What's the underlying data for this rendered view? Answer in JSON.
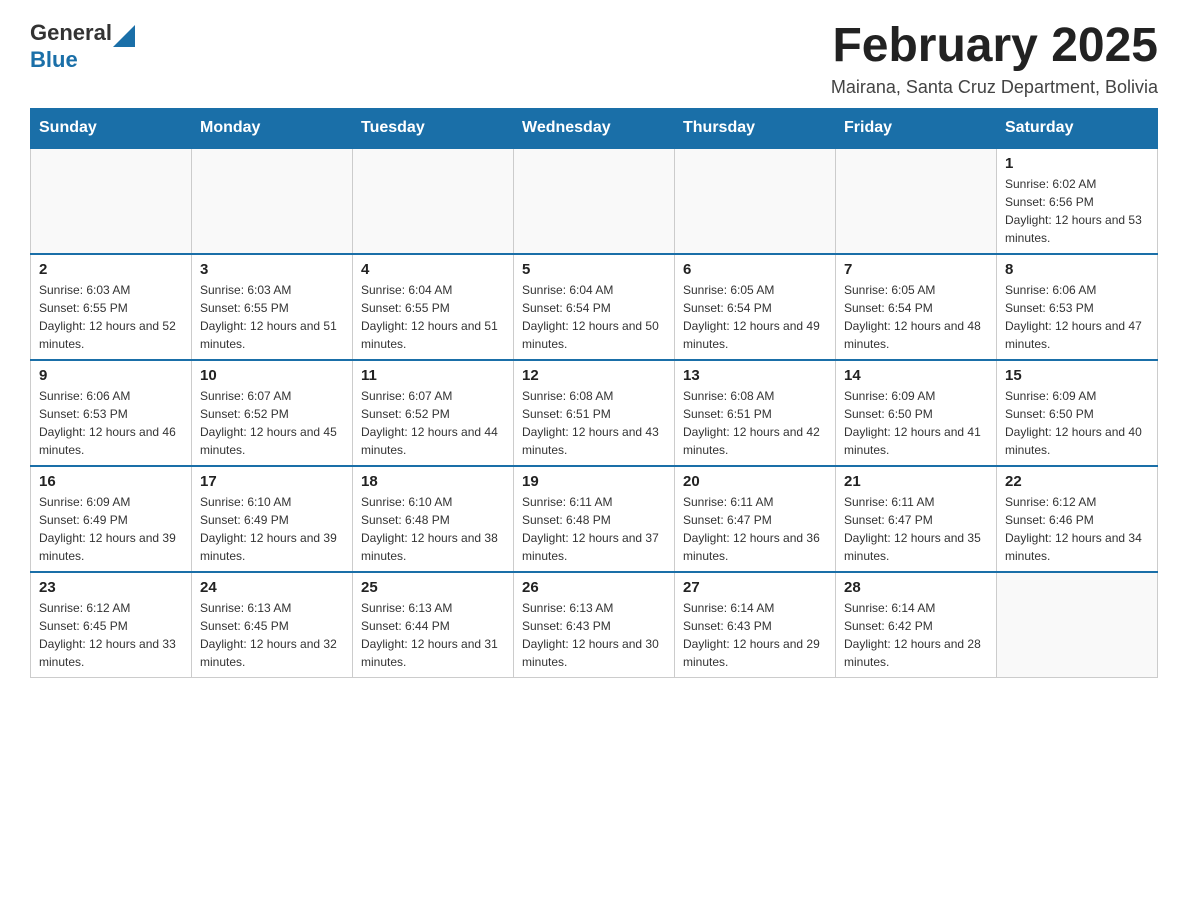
{
  "logo": {
    "general": "General",
    "blue": "Blue"
  },
  "header": {
    "title": "February 2025",
    "subtitle": "Mairana, Santa Cruz Department, Bolivia"
  },
  "weekdays": [
    "Sunday",
    "Monday",
    "Tuesday",
    "Wednesday",
    "Thursday",
    "Friday",
    "Saturday"
  ],
  "weeks": [
    [
      {
        "day": "",
        "info": ""
      },
      {
        "day": "",
        "info": ""
      },
      {
        "day": "",
        "info": ""
      },
      {
        "day": "",
        "info": ""
      },
      {
        "day": "",
        "info": ""
      },
      {
        "day": "",
        "info": ""
      },
      {
        "day": "1",
        "info": "Sunrise: 6:02 AM\nSunset: 6:56 PM\nDaylight: 12 hours and 53 minutes."
      }
    ],
    [
      {
        "day": "2",
        "info": "Sunrise: 6:03 AM\nSunset: 6:55 PM\nDaylight: 12 hours and 52 minutes."
      },
      {
        "day": "3",
        "info": "Sunrise: 6:03 AM\nSunset: 6:55 PM\nDaylight: 12 hours and 51 minutes."
      },
      {
        "day": "4",
        "info": "Sunrise: 6:04 AM\nSunset: 6:55 PM\nDaylight: 12 hours and 51 minutes."
      },
      {
        "day": "5",
        "info": "Sunrise: 6:04 AM\nSunset: 6:54 PM\nDaylight: 12 hours and 50 minutes."
      },
      {
        "day": "6",
        "info": "Sunrise: 6:05 AM\nSunset: 6:54 PM\nDaylight: 12 hours and 49 minutes."
      },
      {
        "day": "7",
        "info": "Sunrise: 6:05 AM\nSunset: 6:54 PM\nDaylight: 12 hours and 48 minutes."
      },
      {
        "day": "8",
        "info": "Sunrise: 6:06 AM\nSunset: 6:53 PM\nDaylight: 12 hours and 47 minutes."
      }
    ],
    [
      {
        "day": "9",
        "info": "Sunrise: 6:06 AM\nSunset: 6:53 PM\nDaylight: 12 hours and 46 minutes."
      },
      {
        "day": "10",
        "info": "Sunrise: 6:07 AM\nSunset: 6:52 PM\nDaylight: 12 hours and 45 minutes."
      },
      {
        "day": "11",
        "info": "Sunrise: 6:07 AM\nSunset: 6:52 PM\nDaylight: 12 hours and 44 minutes."
      },
      {
        "day": "12",
        "info": "Sunrise: 6:08 AM\nSunset: 6:51 PM\nDaylight: 12 hours and 43 minutes."
      },
      {
        "day": "13",
        "info": "Sunrise: 6:08 AM\nSunset: 6:51 PM\nDaylight: 12 hours and 42 minutes."
      },
      {
        "day": "14",
        "info": "Sunrise: 6:09 AM\nSunset: 6:50 PM\nDaylight: 12 hours and 41 minutes."
      },
      {
        "day": "15",
        "info": "Sunrise: 6:09 AM\nSunset: 6:50 PM\nDaylight: 12 hours and 40 minutes."
      }
    ],
    [
      {
        "day": "16",
        "info": "Sunrise: 6:09 AM\nSunset: 6:49 PM\nDaylight: 12 hours and 39 minutes."
      },
      {
        "day": "17",
        "info": "Sunrise: 6:10 AM\nSunset: 6:49 PM\nDaylight: 12 hours and 39 minutes."
      },
      {
        "day": "18",
        "info": "Sunrise: 6:10 AM\nSunset: 6:48 PM\nDaylight: 12 hours and 38 minutes."
      },
      {
        "day": "19",
        "info": "Sunrise: 6:11 AM\nSunset: 6:48 PM\nDaylight: 12 hours and 37 minutes."
      },
      {
        "day": "20",
        "info": "Sunrise: 6:11 AM\nSunset: 6:47 PM\nDaylight: 12 hours and 36 minutes."
      },
      {
        "day": "21",
        "info": "Sunrise: 6:11 AM\nSunset: 6:47 PM\nDaylight: 12 hours and 35 minutes."
      },
      {
        "day": "22",
        "info": "Sunrise: 6:12 AM\nSunset: 6:46 PM\nDaylight: 12 hours and 34 minutes."
      }
    ],
    [
      {
        "day": "23",
        "info": "Sunrise: 6:12 AM\nSunset: 6:45 PM\nDaylight: 12 hours and 33 minutes."
      },
      {
        "day": "24",
        "info": "Sunrise: 6:13 AM\nSunset: 6:45 PM\nDaylight: 12 hours and 32 minutes."
      },
      {
        "day": "25",
        "info": "Sunrise: 6:13 AM\nSunset: 6:44 PM\nDaylight: 12 hours and 31 minutes."
      },
      {
        "day": "26",
        "info": "Sunrise: 6:13 AM\nSunset: 6:43 PM\nDaylight: 12 hours and 30 minutes."
      },
      {
        "day": "27",
        "info": "Sunrise: 6:14 AM\nSunset: 6:43 PM\nDaylight: 12 hours and 29 minutes."
      },
      {
        "day": "28",
        "info": "Sunrise: 6:14 AM\nSunset: 6:42 PM\nDaylight: 12 hours and 28 minutes."
      },
      {
        "day": "",
        "info": ""
      }
    ]
  ]
}
